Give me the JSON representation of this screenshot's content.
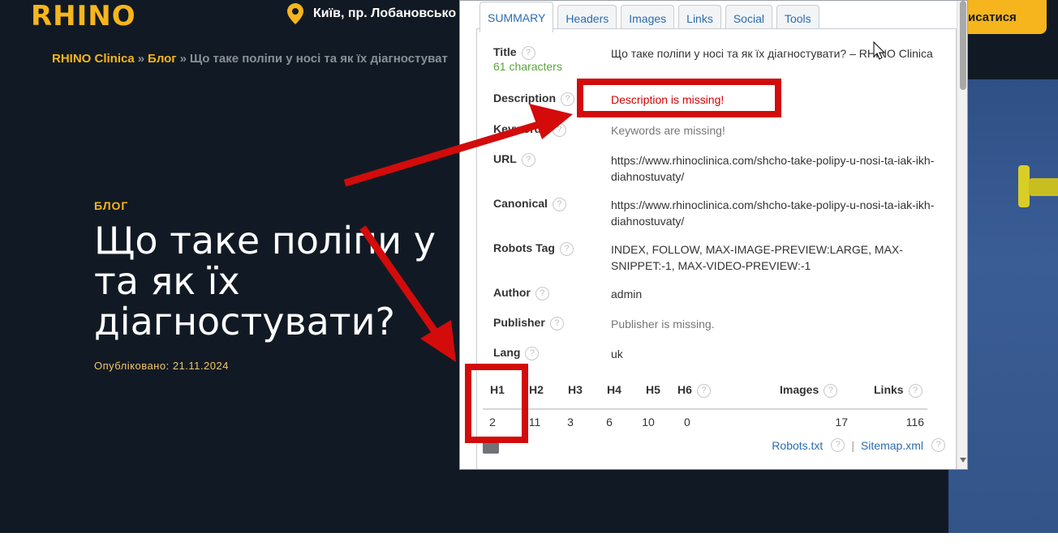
{
  "site": {
    "logo": "RHINO",
    "location": "Київ, пр. Лобановсько",
    "cta": "писатися",
    "breadcrumb": {
      "home": "RHINO Clinica",
      "sep": "»",
      "blog": "Блог",
      "current": "Що таке поліпи у носі та як їх діагностуват"
    },
    "eyebrow": "БЛОГ",
    "title_lines": [
      "Що таке поліпи у",
      "та як їх",
      "діагностувати?"
    ],
    "published": "Опубліковано: 21.11.2024"
  },
  "popup": {
    "tabs": [
      "SUMMARY",
      "Headers",
      "Images",
      "Links",
      "Social",
      "Tools"
    ],
    "active_tab": "SUMMARY",
    "rows": {
      "title": {
        "label": "Title",
        "sub": "61 characters",
        "value": "Що таке поліпи у носі та як їх діагностувати? – RHINO Clinica"
      },
      "description": {
        "label": "Description",
        "value": "Description is missing!"
      },
      "keywords": {
        "label": "Keywords",
        "value": "Keywords are missing!"
      },
      "url": {
        "label": "URL",
        "value": "https://www.rhinoclinica.com/shcho-take-polipy-u-nosi-ta-iak-ikh-diahnostuvaty/"
      },
      "canonical": {
        "label": "Canonical",
        "value": "https://www.rhinoclinica.com/shcho-take-polipy-u-nosi-ta-iak-ikh-diahnostuvaty/"
      },
      "robots": {
        "label": "Robots Tag",
        "value": "INDEX, FOLLOW, MAX-IMAGE-PREVIEW:LARGE, MAX-SNIPPET:-1, MAX-VIDEO-PREVIEW:-1"
      },
      "author": {
        "label": "Author",
        "value": "admin"
      },
      "publisher": {
        "label": "Publisher",
        "value": "Publisher is missing."
      },
      "lang": {
        "label": "Lang",
        "value": "uk"
      }
    },
    "help_glyph": "?",
    "headings": {
      "labels": [
        "H1",
        "H2",
        "H3",
        "H4",
        "H5",
        "H6",
        "Images",
        "Links"
      ],
      "values": [
        "2",
        "11",
        "3",
        "6",
        "10",
        "0",
        "17",
        "116"
      ]
    },
    "footer": {
      "robots": "Robots.txt",
      "divider": "|",
      "sitemap": "Sitemap.xml"
    }
  },
  "colors": {
    "accent": "#f6b51c",
    "background": "#111a24",
    "highlight_box": "#d30b0b",
    "link": "#2b6cb0",
    "missing": "#d50000"
  },
  "icons": [
    "location-pin-icon",
    "help-icon",
    "chart-icon",
    "scroll-down-icon",
    "mouse-cursor-icon",
    "annotation-arrow"
  ]
}
